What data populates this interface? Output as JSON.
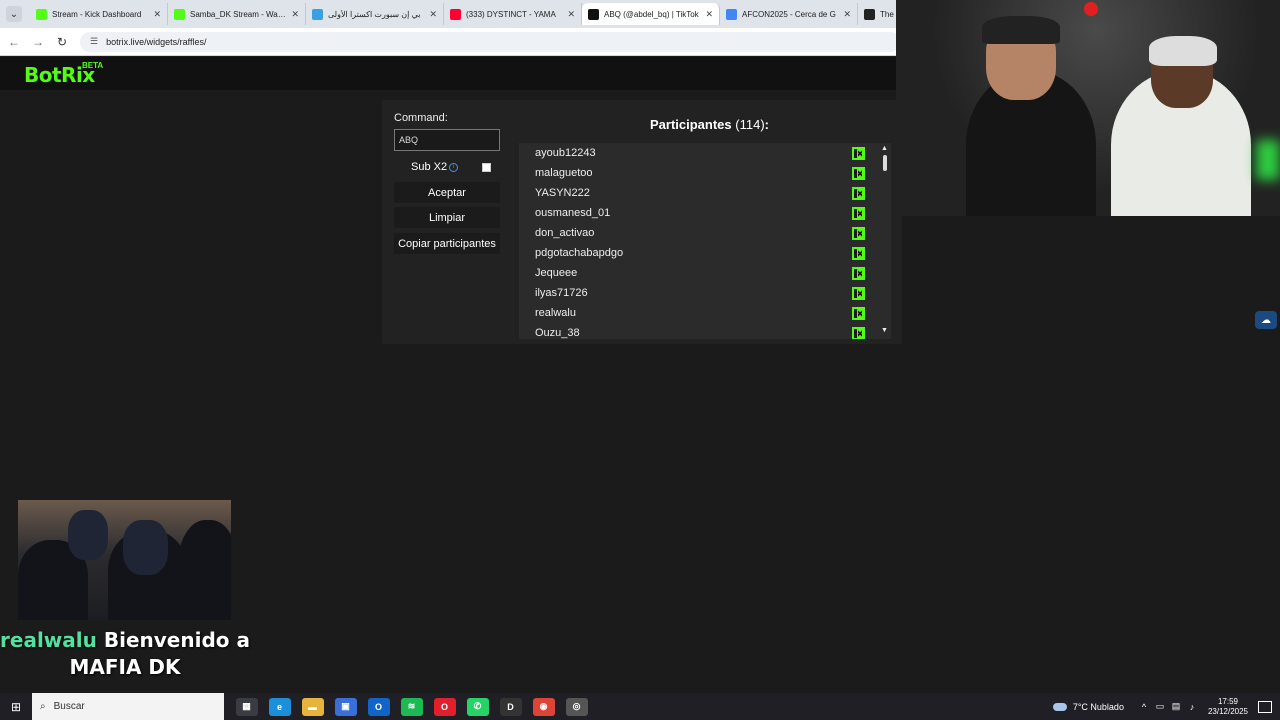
{
  "browser": {
    "tabs": [
      {
        "title": "Stream - Kick Dashboard",
        "favicon": "kick-icon",
        "color": "#53fc18",
        "active": false
      },
      {
        "title": "Samba_DK Stream - Watch",
        "favicon": "kick-icon",
        "color": "#53fc18",
        "active": false
      },
      {
        "title": "بي إن سبورت اكسترا الأولى",
        "favicon": "globe-icon",
        "color": "#3aa0e0",
        "active": false
      },
      {
        "title": "(333) DYSTINCT - YAMA",
        "favicon": "youtube-icon",
        "color": "#ff0033",
        "active": false
      },
      {
        "title": "ABQ (@abdel_bq) | TikTok",
        "favicon": "tiktok-icon",
        "color": "#111111",
        "active": true
      },
      {
        "title": "AFCON2025 - Cerca de G",
        "favicon": "google-icon",
        "color": "#4285f4",
        "active": false
      },
      {
        "title": "The",
        "favicon": "github-icon",
        "color": "#222222",
        "active": false
      }
    ],
    "url": "botrix.live/widgets/raffles/"
  },
  "botrix": {
    "logo": "BotRix",
    "badge": "BETA",
    "brand_color": "#53fc18"
  },
  "raffle": {
    "command_label": "Command:",
    "command_value": "ABQ",
    "sub_label": "Sub X2",
    "sub_checked": false,
    "accept_label": "Aceptar",
    "clear_label": "Limpiar",
    "copy_label": "Copiar participantes",
    "participants_title": "Participantes",
    "participants_count": "(114)",
    "participants_suffix": ":",
    "participants": [
      "ayoub12243",
      "malaguetoo",
      "YASYN222",
      "ousmanesd_01",
      "don_activao",
      "pdgotachabapdgo",
      "Jequeee",
      "ilyas71726",
      "realwalu",
      "Ouzu_38"
    ]
  },
  "overlay": {
    "welcome_user": "realwalu",
    "welcome_text": "Bienvenido a",
    "welcome_channel": "MAFIA DK"
  },
  "taskbar": {
    "search_placeholder": "Buscar",
    "apps": [
      {
        "name": "task-view-icon",
        "glyph": "▦",
        "color": "#3b3b44"
      },
      {
        "name": "edge-icon",
        "glyph": "e",
        "color": "#1d8ed8"
      },
      {
        "name": "file-explorer-icon",
        "glyph": "▬",
        "color": "#e8b33a"
      },
      {
        "name": "store-icon",
        "glyph": "▣",
        "color": "#3a6fd8"
      },
      {
        "name": "outlook-icon",
        "glyph": "O",
        "color": "#1066c8"
      },
      {
        "name": "spotify-icon",
        "glyph": "≋",
        "color": "#1db954"
      },
      {
        "name": "opera-icon",
        "glyph": "O",
        "color": "#e0202c"
      },
      {
        "name": "whatsapp-icon",
        "glyph": "✆",
        "color": "#25d366"
      },
      {
        "name": "app-d-icon",
        "glyph": "D",
        "color": "#333333"
      },
      {
        "name": "chrome-icon",
        "glyph": "◉",
        "color": "#db4437"
      },
      {
        "name": "obs-icon",
        "glyph": "◎",
        "color": "#555555"
      }
    ],
    "weather": "7°C  Nublado",
    "time": "17:59",
    "date": "23/12/2025"
  }
}
